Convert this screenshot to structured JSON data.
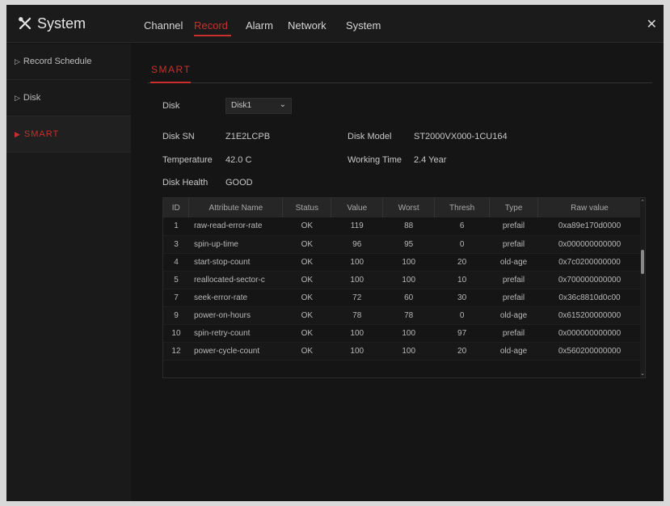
{
  "title": "System",
  "tabs": [
    "Channel",
    "Record",
    "Alarm",
    "Network",
    "System"
  ],
  "active_tab": "Record",
  "sidebar": {
    "items": [
      {
        "label": "Record Schedule",
        "arrow": "▷"
      },
      {
        "label": "Disk",
        "arrow": "▷"
      },
      {
        "label": "SMART",
        "arrow": "▶"
      }
    ],
    "active": "SMART"
  },
  "section_title": "SMART",
  "fields": {
    "disk_label": "Disk",
    "disk_value": "Disk1",
    "disk_sn_label": "Disk SN",
    "disk_sn_value": "Z1E2LCPB",
    "disk_model_label": "Disk Model",
    "disk_model_value": "ST2000VX000-1CU164",
    "temperature_label": "Temperature",
    "temperature_value": "42.0 C",
    "working_time_label": "Working Time",
    "working_time_value": "2.4 Year",
    "disk_health_label": "Disk Health",
    "disk_health_value": "GOOD"
  },
  "table": {
    "headers": [
      "ID",
      "Attribute Name",
      "Status",
      "Value",
      "Worst",
      "Thresh",
      "Type",
      "Raw value"
    ],
    "rows": [
      [
        "1",
        "raw-read-error-rate",
        "OK",
        "119",
        "88",
        "6",
        "prefail",
        "0xa89e170d0000"
      ],
      [
        "3",
        "spin-up-time",
        "OK",
        "96",
        "95",
        "0",
        "prefail",
        "0x000000000000"
      ],
      [
        "4",
        "start-stop-count",
        "OK",
        "100",
        "100",
        "20",
        "old-age",
        "0x7c0200000000"
      ],
      [
        "5",
        "reallocated-sector-c",
        "OK",
        "100",
        "100",
        "10",
        "prefail",
        "0x700000000000"
      ],
      [
        "7",
        "seek-error-rate",
        "OK",
        "72",
        "60",
        "30",
        "prefail",
        "0x36c8810d0c00"
      ],
      [
        "9",
        "power-on-hours",
        "OK",
        "78",
        "78",
        "0",
        "old-age",
        "0x615200000000"
      ],
      [
        "10",
        "spin-retry-count",
        "OK",
        "100",
        "100",
        "97",
        "prefail",
        "0x000000000000"
      ],
      [
        "12",
        "power-cycle-count",
        "OK",
        "100",
        "100",
        "20",
        "old-age",
        "0x560200000000"
      ]
    ]
  },
  "icons": {
    "app": "tools-icon",
    "close": "close-icon",
    "dropdown": "chevron-down-icon"
  },
  "colors": {
    "accent": "#c9302c",
    "background": "#141414"
  }
}
